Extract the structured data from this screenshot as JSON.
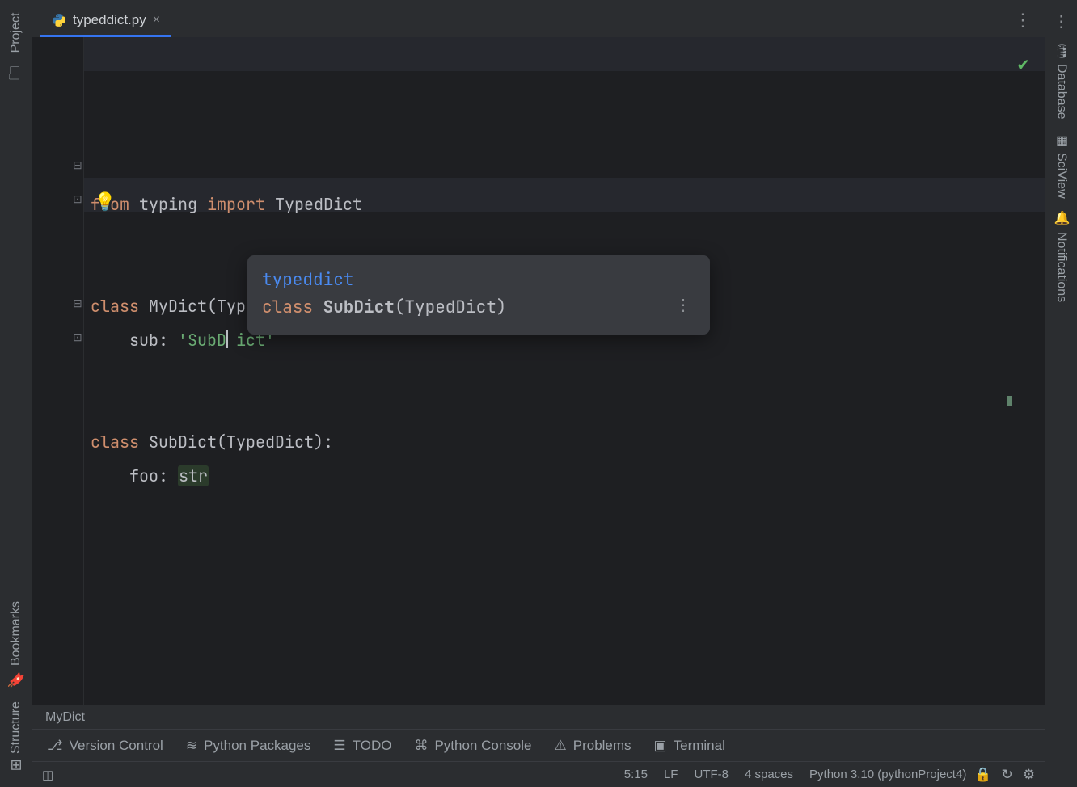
{
  "tab": {
    "filename": "typeddict.py"
  },
  "left_panel": {
    "project": "Project",
    "bookmarks": "Bookmarks",
    "structure": "Structure"
  },
  "right_panel": {
    "database": "Database",
    "sciview": "SciView",
    "notifications": "Notifications"
  },
  "code": {
    "line1_from": "from ",
    "line1_typing": "typing ",
    "line1_import": "import ",
    "line1_typeddict": "TypedDict",
    "line3_class": "class ",
    "line3_name": "MyDict",
    "line3_paren": "(TypedDict):",
    "line4_indent": "    sub: ",
    "line4_str1": "'SubD",
    "line4_str2": "ict'",
    "line7_class": "class ",
    "line7_name": "SubDict",
    "line7_paren": "(TypedDict):",
    "line8_indent": "    foo: ",
    "line8_type": "str"
  },
  "tooltip": {
    "module": "typeddict",
    "decl_class": "class ",
    "decl_name": "SubDict",
    "decl_paren": "(TypedDict)"
  },
  "breadcrumb": {
    "current": "MyDict"
  },
  "bottom": {
    "version_control": "Version Control",
    "python_packages": "Python Packages",
    "todo": "TODO",
    "python_console": "Python Console",
    "problems": "Problems",
    "terminal": "Terminal"
  },
  "status": {
    "pos": "5:15",
    "ending": "LF",
    "encoding": "UTF-8",
    "indent": "4 spaces",
    "interpreter": "Python 3.10 (pythonProject4)"
  }
}
